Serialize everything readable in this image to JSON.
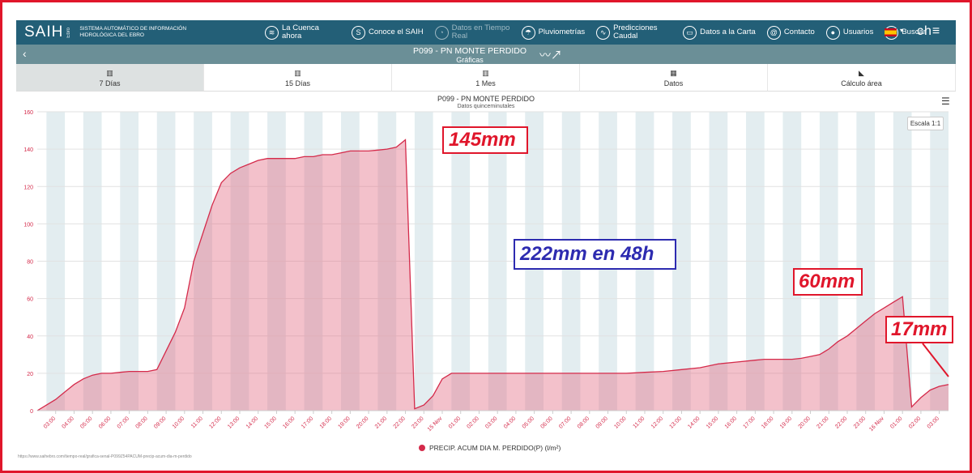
{
  "header": {
    "logo": "SAIH",
    "logo_sub": "Ebro",
    "logo_desc": "SISTEMA AUTOMÁTICO DE INFORMACIÓN HIDROLÓGICA DEL EBRO",
    "nav": [
      {
        "label": "La Cuenca ahora",
        "icon": "layers-icon",
        "glyph": "≋",
        "dim": false
      },
      {
        "label": "Conoce el SAIH",
        "icon": "dollar-circle-icon",
        "glyph": "S",
        "dim": false
      },
      {
        "label": "Datos en Tiempo Real",
        "icon": "clock-icon",
        "glyph": "◔",
        "dim": true
      },
      {
        "label": "Pluviometrías",
        "icon": "umbrella-icon",
        "glyph": "☂",
        "dim": false
      },
      {
        "label": "Predicciones Caudal",
        "icon": "trend-icon",
        "glyph": "∿",
        "dim": false
      },
      {
        "label": "Datos a la Carta",
        "icon": "folder-icon",
        "glyph": "▭",
        "dim": false
      },
      {
        "label": "Contacto",
        "icon": "at-icon",
        "glyph": "@",
        "dim": false
      },
      {
        "label": "Usuarios",
        "icon": "user-icon",
        "glyph": "●",
        "dim": false
      },
      {
        "label": "Buscar",
        "icon": "search-icon",
        "glyph": "⌕",
        "dim": false
      }
    ],
    "brand": "ch≡"
  },
  "titlebar": {
    "title": "P099 - PN MONTE PERDIDO",
    "subtitle": "Gráficas"
  },
  "tabs": [
    {
      "label": "7 Días",
      "active": true
    },
    {
      "label": "15 Días",
      "active": false
    },
    {
      "label": "1 Mes",
      "active": false
    },
    {
      "label": "Datos",
      "active": false
    },
    {
      "label": "Cálculo área",
      "active": false
    }
  ],
  "chart_data": {
    "type": "area",
    "title": "P099 - PN MONTE PERDIDO",
    "subtitle": "Datos quinceminutales",
    "ylim": [
      0,
      160
    ],
    "yticks": [
      0,
      20,
      40,
      60,
      80,
      100,
      120,
      140,
      160
    ],
    "color": "#d42a4a",
    "fill": "rgba(226,108,132,0.42)",
    "grid": true,
    "legend_position": "bottom",
    "x": [
      0,
      0.5,
      1,
      1.5,
      2,
      2.5,
      3,
      3.5,
      4,
      4.5,
      5,
      5.5,
      6,
      6.5,
      7,
      7.5,
      8,
      8.5,
      9,
      9.5,
      10,
      10.5,
      11,
      11.5,
      12,
      12.5,
      13,
      13.5,
      14,
      14.5,
      15,
      15.5,
      16,
      16.5,
      17,
      17.5,
      18,
      18.5,
      19,
      19.5,
      20,
      20.5,
      21,
      21.5,
      22,
      22.5,
      23,
      23.5,
      23.9,
      24,
      24.5,
      25,
      25.5,
      26,
      27,
      28,
      29,
      30,
      31,
      32,
      33,
      34,
      35,
      36,
      37,
      38,
      39,
      39.5,
      40,
      40.5,
      41,
      41.5,
      42,
      42.5,
      43,
      43.5,
      44,
      44.5,
      45,
      45.5,
      46,
      46.5,
      47,
      47.5,
      48,
      48.5,
      49,
      49.5
    ],
    "series": [
      {
        "name": "PRECIP. ACUM DIA M. PERDIDO(P) (l/m²)",
        "values": [
          0,
          3,
          6,
          10,
          14,
          17,
          19,
          20,
          20,
          20.5,
          21,
          21,
          21,
          22,
          32,
          42,
          55,
          80,
          95,
          110,
          122,
          127,
          130,
          132,
          134,
          135,
          135,
          135,
          135,
          136,
          136,
          137,
          137,
          138,
          139,
          139,
          139,
          139.5,
          140,
          141,
          145,
          1,
          3,
          8,
          17,
          20,
          20,
          20,
          20,
          20,
          20,
          20,
          20,
          20,
          20,
          20,
          20,
          20,
          20,
          20,
          20.5,
          21,
          22,
          23,
          25,
          26,
          27,
          27.5,
          27.5,
          27.5,
          27.5,
          28,
          29,
          30,
          33,
          37,
          40,
          44,
          48,
          52,
          55,
          58,
          61,
          2,
          7,
          11,
          13,
          14,
          14,
          15
        ]
      }
    ],
    "xticks": [
      {
        "x": 1,
        "label": "03:00"
      },
      {
        "x": 2,
        "label": "04:00"
      },
      {
        "x": 3,
        "label": "05:00"
      },
      {
        "x": 4,
        "label": "06:00"
      },
      {
        "x": 5,
        "label": "07:00"
      },
      {
        "x": 6,
        "label": "08:00"
      },
      {
        "x": 7,
        "label": "09:00"
      },
      {
        "x": 8,
        "label": "10:00"
      },
      {
        "x": 9,
        "label": "11:00"
      },
      {
        "x": 10,
        "label": "12:00"
      },
      {
        "x": 11,
        "label": "13:00"
      },
      {
        "x": 12,
        "label": "14:00"
      },
      {
        "x": 13,
        "label": "15:00"
      },
      {
        "x": 14,
        "label": "16:00"
      },
      {
        "x": 15,
        "label": "17:00"
      },
      {
        "x": 16,
        "label": "18:00"
      },
      {
        "x": 17,
        "label": "19:00"
      },
      {
        "x": 18,
        "label": "20:00"
      },
      {
        "x": 19,
        "label": "21:00"
      },
      {
        "x": 20,
        "label": "22:00"
      },
      {
        "x": 21,
        "label": "23:00"
      },
      {
        "x": 22,
        "label": "15 Nov"
      },
      {
        "x": 23,
        "label": "01:00"
      },
      {
        "x": 24,
        "label": "02:00"
      },
      {
        "x": 25,
        "label": "03:00"
      },
      {
        "x": 26,
        "label": "04:00"
      },
      {
        "x": 27,
        "label": "05:00"
      },
      {
        "x": 28,
        "label": "06:00"
      },
      {
        "x": 29,
        "label": "07:00"
      },
      {
        "x": 30,
        "label": "08:00"
      },
      {
        "x": 31,
        "label": "09:00"
      },
      {
        "x": 32,
        "label": "10:00"
      },
      {
        "x": 33,
        "label": "11:00"
      },
      {
        "x": 34,
        "label": "12:00"
      },
      {
        "x": 35,
        "label": "13:00"
      },
      {
        "x": 36,
        "label": "14:00"
      },
      {
        "x": 37,
        "label": "15:00"
      },
      {
        "x": 38,
        "label": "16:00"
      },
      {
        "x": 39,
        "label": "17:00"
      },
      {
        "x": 40,
        "label": "18:00"
      },
      {
        "x": 41,
        "label": "19:00"
      },
      {
        "x": 42,
        "label": "20:00"
      },
      {
        "x": 43,
        "label": "21:00"
      },
      {
        "x": 44,
        "label": "22:00"
      },
      {
        "x": 45,
        "label": "23:00"
      },
      {
        "x": 46,
        "label": "16 Nov"
      },
      {
        "x": 47,
        "label": "01:00"
      },
      {
        "x": 48,
        "label": "02:00"
      },
      {
        "x": 49,
        "label": "03:00"
      }
    ],
    "annotations": [
      {
        "text": "145mm",
        "color": "#e0162b"
      },
      {
        "text": "222mm en 48h",
        "color": "#2d2bb0"
      },
      {
        "text": "60mm",
        "color": "#e0162b"
      },
      {
        "text": "17mm",
        "color": "#e0162b"
      }
    ]
  },
  "chart_ui": {
    "scale_button": "Escala 1:1",
    "menu_icon": "hamburger-menu-icon"
  },
  "footer": {
    "url": "https://www.saihebro.com/tiempo-real/grafica-senal-P099Z54PACUM-precip-acum-dia-m-perdido"
  }
}
